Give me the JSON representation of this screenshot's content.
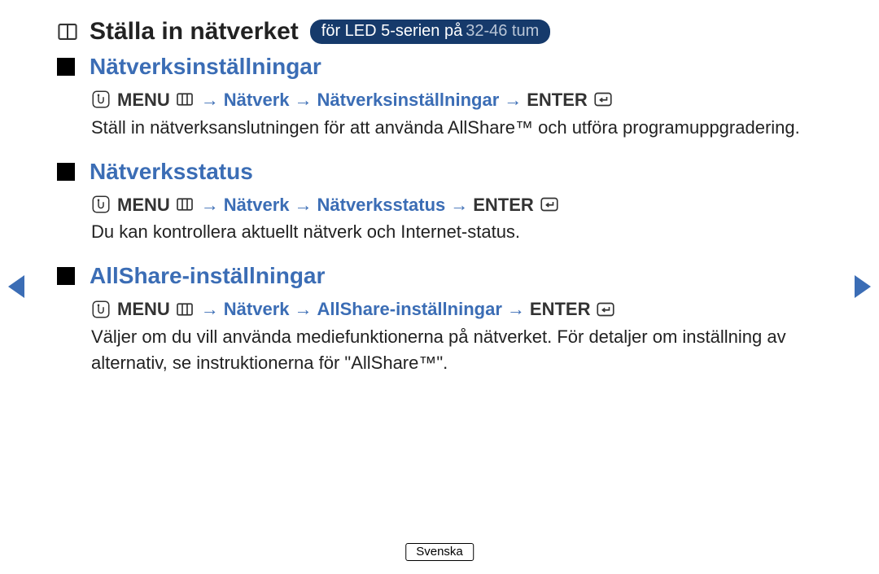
{
  "title": {
    "main": "Ställa in nätverket",
    "pill_pre": "för LED 5-serien på ",
    "pill_range": "32-46 tum"
  },
  "sections": [
    {
      "heading": "Nätverksinställningar",
      "path": {
        "menu": "MENU",
        "steps": [
          "Nätverk",
          "Nätverksinställningar"
        ],
        "enter": "ENTER"
      },
      "desc": "Ställ in nätverksanslutningen för att använda AllShare™ och utföra programuppgradering."
    },
    {
      "heading": "Nätverksstatus",
      "path": {
        "menu": "MENU",
        "steps": [
          "Nätverk",
          "Nätverksstatus"
        ],
        "enter": "ENTER"
      },
      "desc": "Du kan kontrollera aktuellt nätverk och Internet-status."
    },
    {
      "heading": "AllShare-inställningar",
      "path": {
        "menu": "MENU",
        "steps": [
          "Nätverk",
          "AllShare-inställningar"
        ],
        "enter": "ENTER"
      },
      "desc": "Väljer om du vill använda mediefunktionerna på nätverket. För detaljer om inställning av alternativ, se instruktionerna för \"AllShare™\"."
    }
  ],
  "arrow": "→",
  "language": "Svenska"
}
